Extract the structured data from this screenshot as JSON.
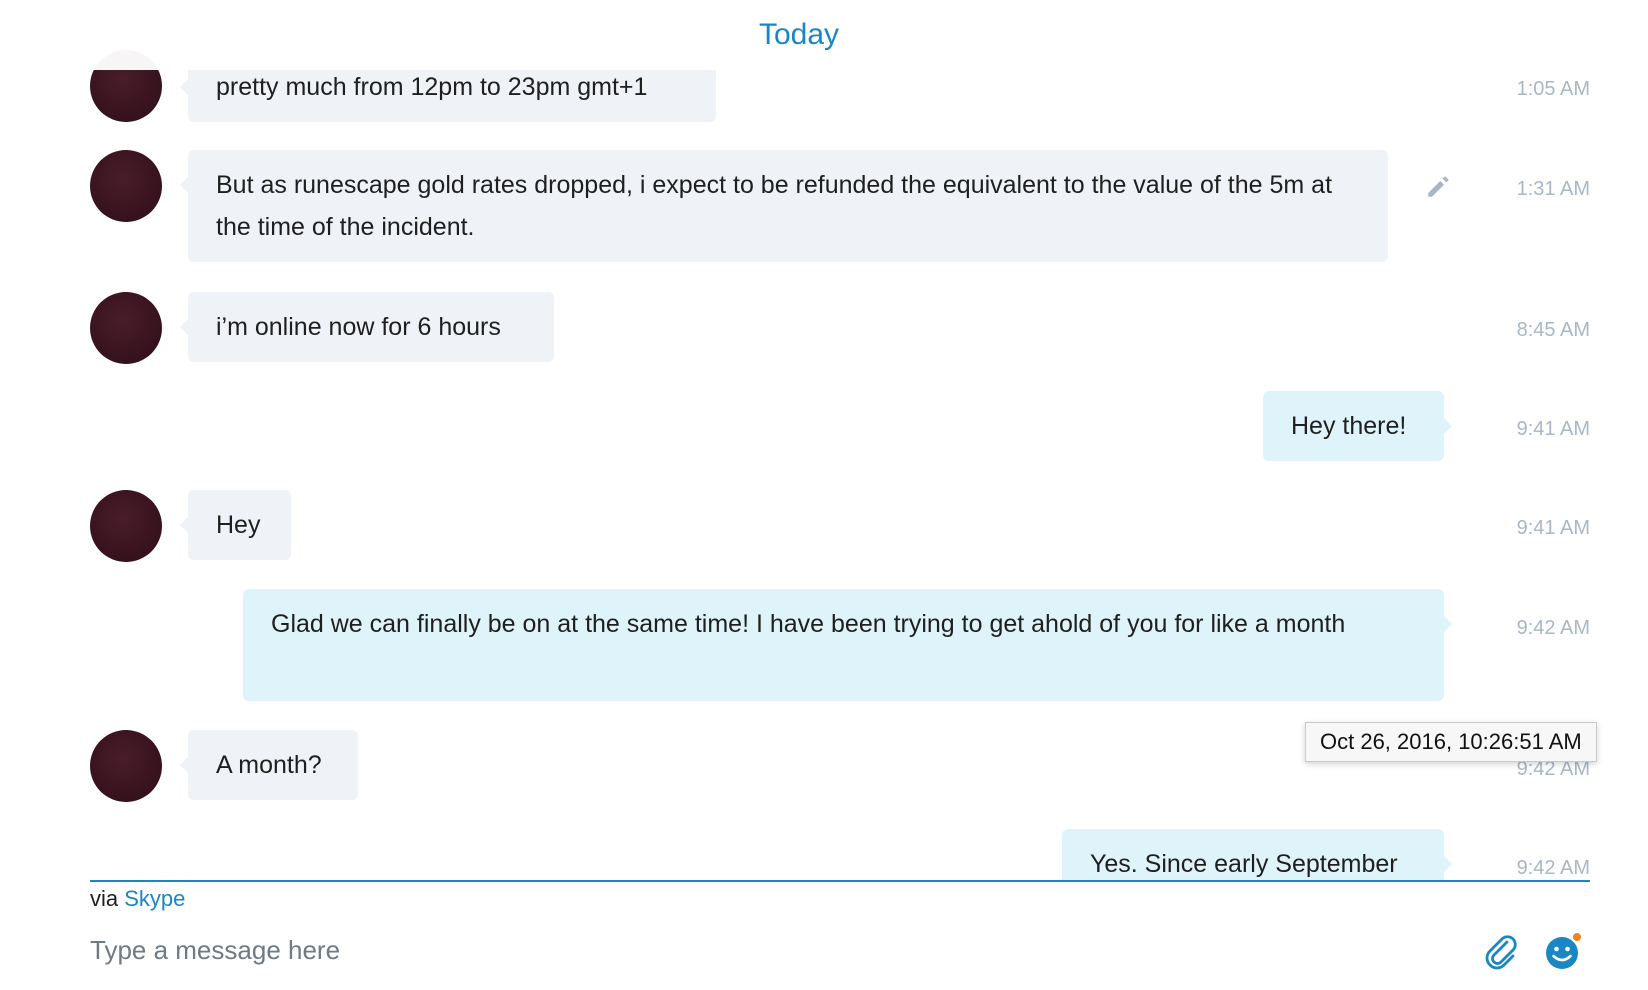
{
  "conversation": {
    "day_label": "Today",
    "messages": [
      {
        "text": "pretty much from 12pm to 23pm gmt+1",
        "time": "1:05 AM",
        "direction": "incoming"
      },
      {
        "text": "But as runescape gold rates dropped, i expect to be refunded the equivalent to the value of the 5m at the time of the incident.",
        "time": "1:31 AM",
        "direction": "incoming"
      },
      {
        "text": "i’m online now for 6 hours",
        "time": "8:45 AM",
        "direction": "incoming"
      },
      {
        "text": "Hey there!",
        "time": "9:41 AM",
        "direction": "outgoing"
      },
      {
        "text": "Hey",
        "time": "9:41 AM",
        "direction": "incoming"
      },
      {
        "text": "Glad we can finally be on at the same time! I have been trying to get ahold of you for like a month",
        "time": "9:42 AM",
        "direction": "outgoing"
      },
      {
        "text": "A month?",
        "time": "9:42 AM",
        "direction": "incoming"
      },
      {
        "text": "Yes. Since early September",
        "time": "9:42 AM",
        "direction": "outgoing"
      }
    ],
    "tooltip": "Oct 26, 2016, 10:26:51 AM"
  },
  "composer": {
    "via_prefix": "via",
    "via_link": "Skype",
    "placeholder": "Type a message here",
    "attach_icon": "paperclip-icon",
    "emoji_icon": "smiley-icon"
  },
  "colors": {
    "accent": "#1a86c4",
    "incoming_bubble": "#eff2f7",
    "outgoing_bubble": "#dff3fb",
    "timestamp": "#a9b7c4",
    "notification_dot": "#f58220"
  }
}
